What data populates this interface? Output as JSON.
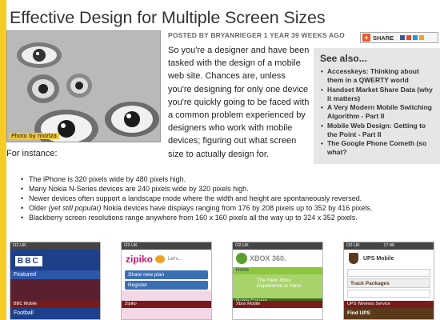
{
  "article": {
    "title": "Effective Design for Multiple Screen Sizes",
    "byline": "POSTED BY BRYANRIEGER 1 YEAR 39 WEEKS AGO",
    "photo_credit": "Photo by moriza",
    "intro": "So you're a designer and have been tasked with the design of a mobile web site. Chances are, unless you're designing for only one device you're quickly going to be faced with a common problem experienced by designers who work with mobile devices; figuring out what screen size to actually design for.",
    "for_instance": "For instance:",
    "facts": [
      "The iPhone is 320 pixels wide by 480 pixels high.",
      "Many Nokia N-Series devices are 240 pixels wide by 320 pixels high.",
      "Newer devices often support a landscape mode where the width and height are spontaneously reversed."
    ],
    "fact_older": {
      "prefix": "Older ",
      "em": "(yet still popular)",
      "suffix": " Nokia devices have displays ranging from 176 by 208 pixels up to 352 by 416 pixels."
    },
    "fact_last": "Blackberry screen resolutions range anywhere from 160 x 160 pixels all the way up to 324 x 352 pixels."
  },
  "share": {
    "label": "SHARE",
    "icon": "addthis-plus-icon"
  },
  "see_also": {
    "heading": "See also...",
    "items": [
      "Accesskeys: Thinking about them in a QWERTY world",
      "Handset Market Share Data (why it matters)",
      "A Very Modern Mobile Switching Algorithm - Part II",
      "Mobile Web Design: Getting to the Point - Part II",
      "The Google Phone Cometh (so what?"
    ]
  },
  "screenshots": [
    {
      "status": "O2-UK",
      "brand": "BBC",
      "subtitle": "Featured",
      "caption": "BBC Mobile",
      "bottom": "Football",
      "accent": "#1e3f8a"
    },
    {
      "status": "O2-UK",
      "brand": "zipiko",
      "tagline": "Let's...",
      "menu": [
        "Share new plan",
        "Register"
      ],
      "caption": "Zipiko",
      "accent": "#d4146d"
    },
    {
      "status": "O2-UK",
      "brand": "XBOX 360.",
      "menu": [
        "Home",
        "Game Catalog"
      ],
      "promo": "The New Xbox Experience is here!",
      "caption": "Xbox Mobile",
      "accent": "#5aa02c"
    },
    {
      "status": "O2-UK",
      "time": "17:46",
      "brand": "UPS Mobile",
      "link": "Track Packages",
      "field": "Find UPS",
      "caption": "UPS Wireless Service",
      "accent": "#5a3a1a"
    }
  ],
  "colors": {
    "page_background": "#f7cc25",
    "sidebar_background": "#e6e6e6"
  }
}
